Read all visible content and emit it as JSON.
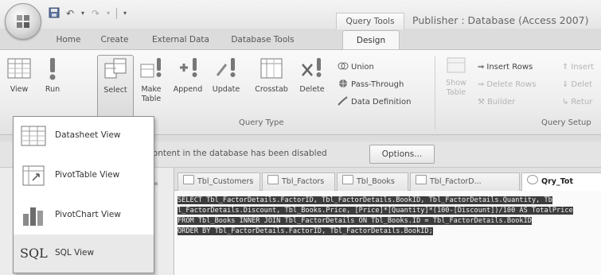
{
  "qat": {
    "icons": [
      "save-icon",
      "undo-icon",
      "redo-icon",
      "customize-icon"
    ]
  },
  "contextual_tab": "Query Tools",
  "window_title": "Publisher : Database (Access 2007)",
  "tabs": [
    {
      "label": "Home"
    },
    {
      "label": "Create"
    },
    {
      "label": "External Data"
    },
    {
      "label": "Database Tools"
    },
    {
      "label": "Design",
      "active": true
    }
  ],
  "ribbon": {
    "view_label": "View",
    "run_label": "Run",
    "select_label": "Select",
    "make_table_label": "Make Table",
    "append_label": "Append",
    "update_label": "Update",
    "crosstab_label": "Crosstab",
    "delete_label": "Delete",
    "union_label": "Union",
    "pass_through_label": "Pass-Through",
    "data_definition_label": "Data Definition",
    "query_type_group": "Query Type",
    "show_table_label": "Show Table",
    "insert_rows_label": "Insert Rows",
    "delete_rows_label": "Delete Rows",
    "builder_label": "Builder",
    "insert_cols_label": "Insert",
    "delete_cols_label": "Delet",
    "return_label": "Retur",
    "query_setup_group": "Query Setup"
  },
  "message_bar": {
    "text": "n content in the database has been disabled",
    "options_label": "Options..."
  },
  "nav": {
    "collapse": "«"
  },
  "doc_tabs": [
    {
      "label": "Tbl_Customers"
    },
    {
      "label": "Tbl_Factors"
    },
    {
      "label": "Tbl_Books"
    },
    {
      "label": "Tbl_FactorD..."
    },
    {
      "label": "Qry_Tot",
      "active": true
    }
  ],
  "sql_lines": [
    "SELECT Tbl_FactorDetails.FactorID, Tbl_FactorDetails.BookID, Tbl_FactorDetails.Quantity, Tb",
    "l_FactorDetails.Discount, Tbl_Books.Price, [Price]*[Quantity]*(100-[Discount])/100 AS TotalPrice",
    "FROM Tbl_Books INNER JOIN Tbl_FactorDetails ON Tbl_Books.ID = Tbl_FactorDetails.BookID",
    "ORDER BY Tbl_FactorDetails.FactorID, Tbl_FactorDetails.BookID;"
  ],
  "view_menu": {
    "items": [
      {
        "label": "Datasheet View",
        "icon": "datasheet-view-icon"
      },
      {
        "label": "PivotTable View",
        "icon": "pivottable-view-icon"
      },
      {
        "label": "PivotChart View",
        "icon": "pivotchart-view-icon"
      },
      {
        "label": "SQL View",
        "icon": "sql-view-icon",
        "glyph": "SQL"
      }
    ]
  }
}
